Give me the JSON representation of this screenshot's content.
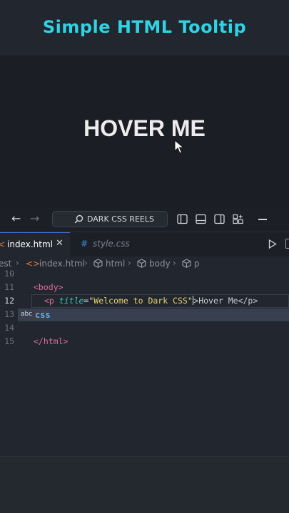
{
  "header": {
    "title": "Simple HTML Tooltip"
  },
  "preview": {
    "hover_text": "HOVER ME"
  },
  "titlebar": {
    "back_icon": "arrow-left-icon",
    "forward_icon": "arrow-right-icon",
    "command_center_label": "DARK CSS REELS",
    "layout_icons": [
      "toggle-primary-sidebar-icon",
      "toggle-panel-icon",
      "toggle-secondary-sidebar-icon",
      "customize-layout-icon"
    ]
  },
  "tabs": [
    {
      "label": "index.html",
      "icon": "<",
      "close": "✕",
      "active": true
    },
    {
      "label": "style.css",
      "icon": "#",
      "active": false
    }
  ],
  "breadcrumb": {
    "folder": "est",
    "file": "index.html",
    "items": [
      "html",
      "body",
      "p"
    ]
  },
  "code": {
    "lines": [
      {
        "num": "10",
        "text": ""
      },
      {
        "num": "11",
        "text": "<body>"
      },
      {
        "num": "12",
        "tag_open": "<p",
        "attr": "title",
        "eq": "=",
        "value": "\"Welcome to Dark CSS\"",
        "after": ">Hover Me</p>"
      },
      {
        "num": "13",
        "text": ""
      },
      {
        "num": "14",
        "text": ""
      },
      {
        "num": "15",
        "text": "</html>"
      }
    ]
  },
  "suggestion": {
    "kind": "abc",
    "word": "css"
  },
  "colors": {
    "accent": "#2fd3e3",
    "tag": "#e06c9a",
    "attr": "#39c8b0",
    "string": "#e6d36c",
    "html_icon": "#e8773a",
    "css_icon": "#3f8ed8"
  }
}
